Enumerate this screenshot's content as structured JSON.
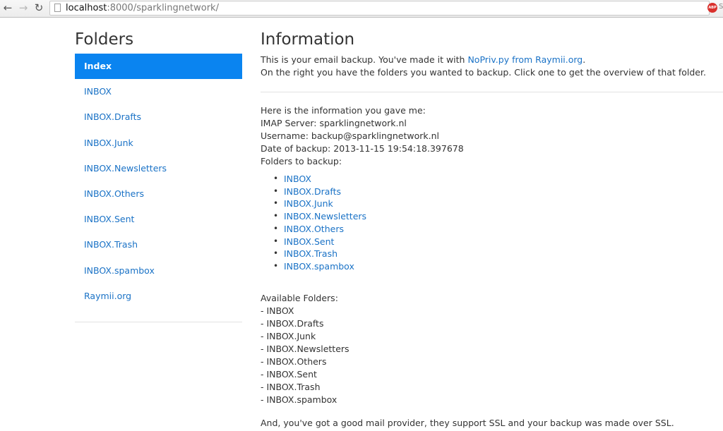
{
  "browser": {
    "back_icon": "arrow-left",
    "forward_icon": "arrow-right",
    "reload_icon": "reload",
    "url_host": "localhost",
    "url_rest": ":8000/sparklingnetwork/",
    "extension_label": "ABP",
    "extension_partial": "S"
  },
  "sidebar": {
    "title": "Folders",
    "items": [
      {
        "label": "Index",
        "active": true
      },
      {
        "label": "INBOX"
      },
      {
        "label": "INBOX.Drafts"
      },
      {
        "label": "INBOX.Junk"
      },
      {
        "label": "INBOX.Newsletters"
      },
      {
        "label": "INBOX.Others"
      },
      {
        "label": "INBOX.Sent"
      },
      {
        "label": "INBOX.Trash"
      },
      {
        "label": "INBOX.spambox"
      },
      {
        "label": "Raymii.org"
      }
    ]
  },
  "main": {
    "title": "Information",
    "intro_prefix": "This is your email backup. You've made it with ",
    "intro_link1": "NoPriv.py",
    "intro_link2": "from Raymii.org",
    "intro_suffix": ".",
    "intro_line2": "On the right you have the folders you wanted to backup. Click one to get the overview of that folder.",
    "info_heading": "Here is the information you gave me:",
    "imap_server": "IMAP Server: sparklingnetwork.nl",
    "username": "Username: backup@sparklingnetwork.nl",
    "backup_date": "Date of backup: 2013-11-15 19:54:18.397678",
    "folders_heading": "Folders to backup:",
    "folders_to_backup": [
      "INBOX",
      "INBOX.Drafts",
      "INBOX.Junk",
      "INBOX.Newsletters",
      "INBOX.Others",
      "INBOX.Sent",
      "INBOX.Trash",
      "INBOX.spambox"
    ],
    "available_heading": "Available Folders:",
    "available_folders": [
      "- INBOX",
      "- INBOX.Drafts",
      "- INBOX.Junk",
      "- INBOX.Newsletters",
      "- INBOX.Others",
      "- INBOX.Sent",
      "- INBOX.Trash",
      "- INBOX.spambox"
    ],
    "ssl_note": "And, you've got a good mail provider, they support SSL and your backup was made over SSL."
  }
}
